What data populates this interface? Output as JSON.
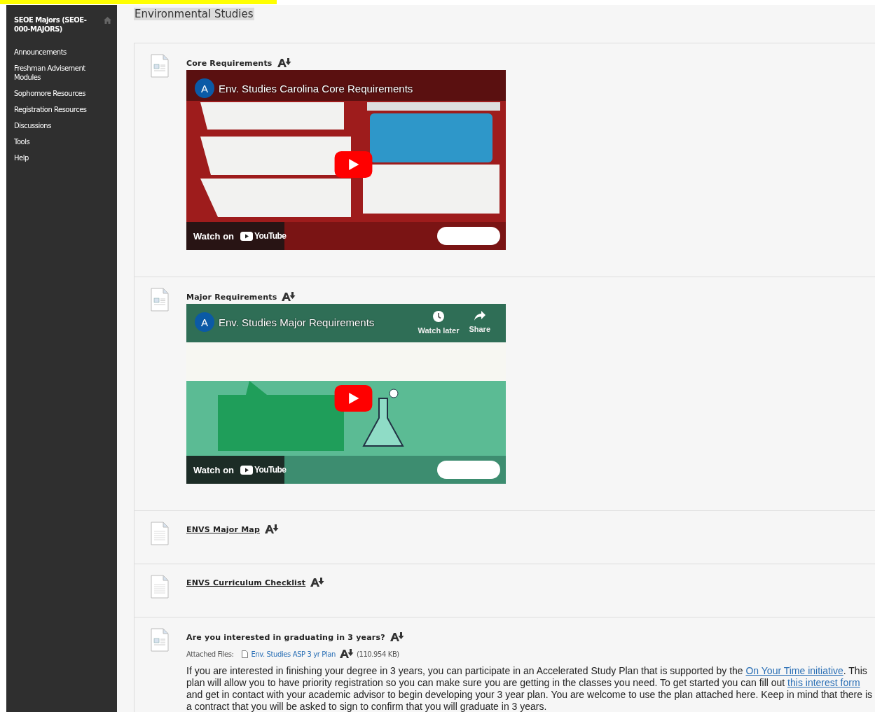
{
  "sidebar": {
    "course_title": "SEOE Majors (SEOE-000-MAJORS)",
    "items": [
      {
        "label": "Announcements"
      },
      {
        "label": "Freshman Advisement Modules"
      },
      {
        "label": "Sophomore Resources"
      },
      {
        "label": "Registration Resources"
      },
      {
        "label": "Discussions"
      },
      {
        "label": "Tools"
      },
      {
        "label": "Help"
      }
    ]
  },
  "page_title": "Environmental Studies",
  "items": [
    {
      "kind": "video",
      "title": "Core Requirements",
      "video": {
        "channel_initial": "A",
        "title": "Env. Studies Carolina Core Requirements",
        "watch_on": "Watch on",
        "brand": "YouTube"
      }
    },
    {
      "kind": "video",
      "title": "Major Requirements",
      "video": {
        "channel_initial": "A",
        "title": "Env. Studies Major Requirements",
        "actions": [
          "Watch later",
          "Share"
        ],
        "watch_on": "Watch on",
        "brand": "YouTube"
      }
    },
    {
      "kind": "file",
      "title": "ENVS Major Map"
    },
    {
      "kind": "file",
      "title": "ENVS Curriculum Checklist"
    },
    {
      "kind": "text",
      "title": "Are you interested in graduating in 3 years?",
      "attachment": {
        "label": "Attached Files:",
        "file": "Env. Studies ASP 3 yr Plan",
        "size": "(110.954 KB)"
      },
      "body": [
        {
          "kind": "text",
          "text": "If you are interested in finishing your degree in 3 years, you can participate in an Accelerated Study Plan that is supported by the "
        },
        {
          "kind": "link",
          "text": "On Your Time initiative"
        },
        {
          "kind": "text",
          "text": ". This plan will allow you to have priority registration so you can make sure you are getting in the classes you need. To get started you can fill out "
        },
        {
          "kind": "link",
          "text": "this interest form"
        },
        {
          "kind": "text",
          "text": " and get in contact with your academic advisor to begin developing your 3 year plan. You are welcome to use the plan attached here. Keep in mind that there is a contract that you will be asked to sign to confirm that you will graduate in 3 years."
        }
      ]
    }
  ]
}
